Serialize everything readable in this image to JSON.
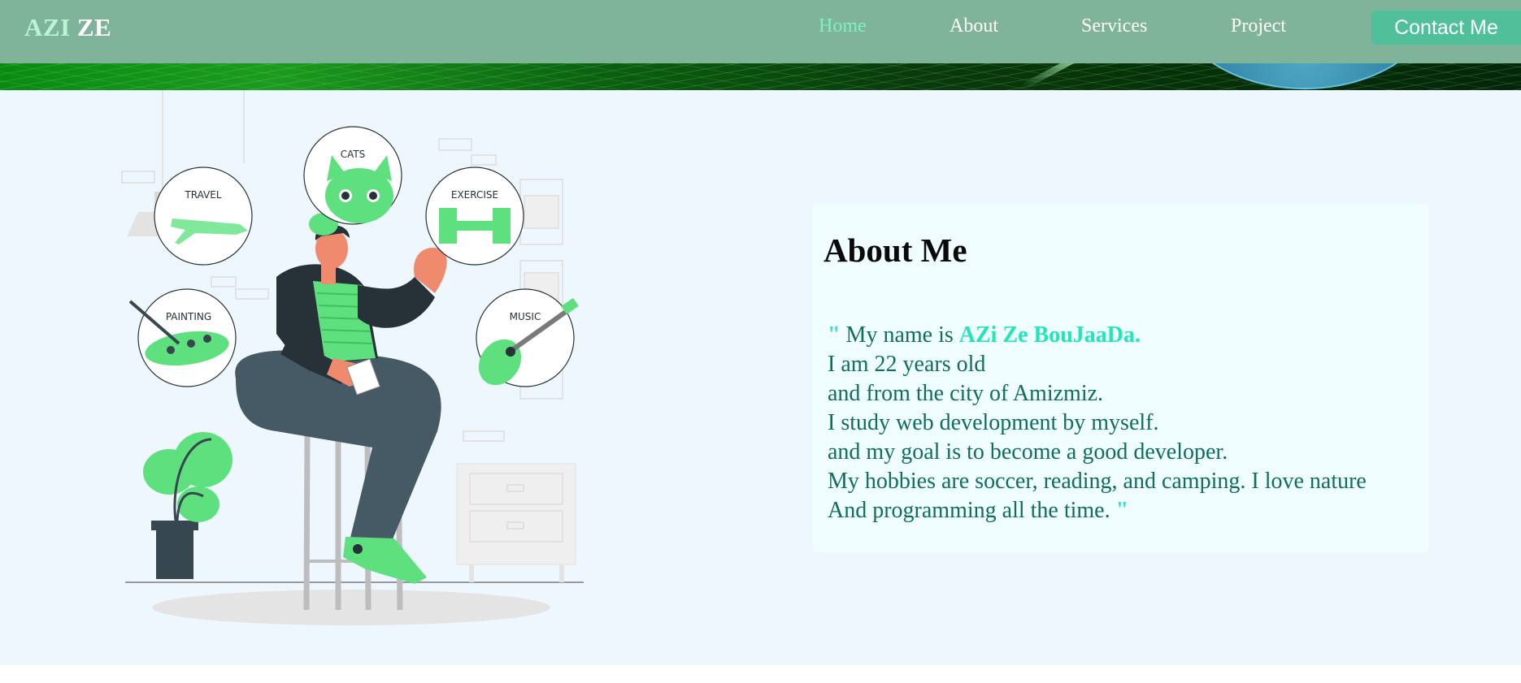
{
  "header": {
    "logo_part1": "AZI",
    "logo_part2": "ZE",
    "nav": [
      {
        "label": "Home",
        "active": true
      },
      {
        "label": "About",
        "active": false
      },
      {
        "label": "Services",
        "active": false
      },
      {
        "label": "Project",
        "active": false
      }
    ],
    "contact_label": "Contact Me"
  },
  "illustration": {
    "hobbies": [
      "TRAVEL",
      "CATS",
      "EXERCISE",
      "PAINTING",
      "MUSIC"
    ]
  },
  "about": {
    "title": "About Me",
    "quote_open": "\"",
    "intro": "My name is",
    "name": "AZi Ze BouJaaDa.",
    "lines": [
      "I am 22 years old",
      "and from the city of Amizmiz.",
      "I study web development by myself.",
      "and my goal is to become a good developer.",
      "My hobbies are soccer, reading, and camping. I love nature"
    ],
    "last_line": "And programming all the time.",
    "quote_close": "\""
  },
  "colors": {
    "nav_bg": "#80b49a",
    "accent": "#4fc09a",
    "active_link": "#7cf2c4",
    "section_bg": "#eef7fe",
    "text_green": "#0f6e5c"
  }
}
